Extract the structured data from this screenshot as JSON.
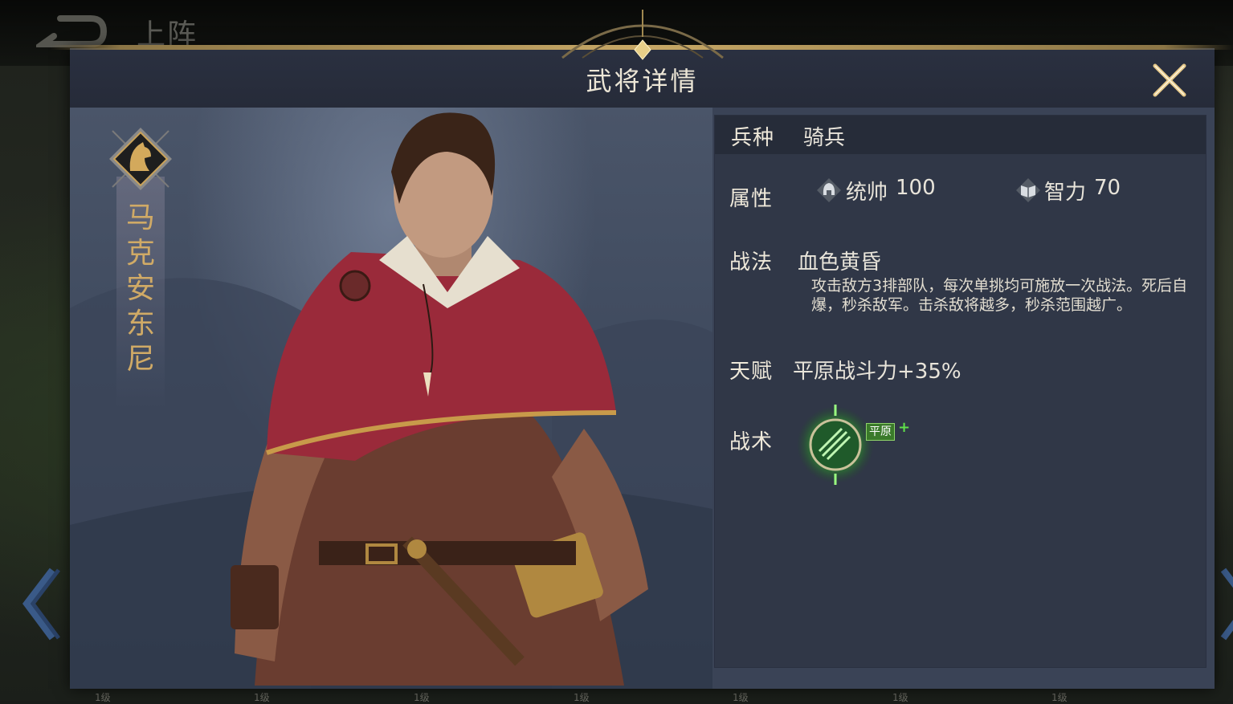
{
  "topbar": {
    "title": "上阵"
  },
  "bottom_levels": [
    "1级",
    "1级",
    "1级",
    "1级",
    "1级",
    "1级",
    "1级"
  ],
  "dialog": {
    "title": "武将详情"
  },
  "hero": {
    "name": "马克安东尼",
    "name_chars": [
      "马",
      "克",
      "安",
      "东",
      "尼"
    ],
    "unit_icon": "horse-icon"
  },
  "info": {
    "troop_label": "兵种",
    "troop_value": "骑兵",
    "attr_label": "属性",
    "attrs": [
      {
        "icon": "helmet-icon",
        "name": "统帅",
        "value": "100"
      },
      {
        "icon": "book-icon",
        "name": "智力",
        "value": "70"
      }
    ],
    "skill_label": "战法",
    "skill_name": "血色黄昏",
    "skill_desc": "攻击敌方3排部队，每次单挑均可施放一次战法。死后自爆，秒杀敌军。击杀敌将越多，秒杀范围越广。",
    "talent_label": "天赋",
    "talent_value": "平原战斗力+35%",
    "tactic_label": "战术",
    "tactic_tag": "平原",
    "tactic_plus": "+"
  },
  "colors": {
    "name_gold": "#d0aa66",
    "panel_bg": "#303747",
    "dialog_bg": "#3a4356",
    "tactic_green": "#3fbf3a"
  }
}
